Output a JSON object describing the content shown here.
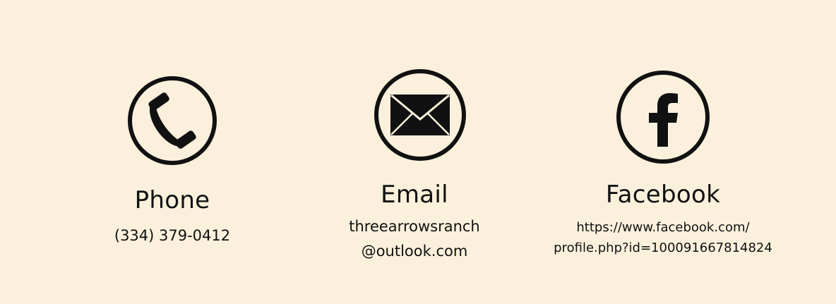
{
  "contacts": {
    "phone": {
      "icon": "phone-icon",
      "label": "Phone",
      "value": "(334) 379-0412"
    },
    "email": {
      "icon": "envelope-icon",
      "label": "Email",
      "value_line1": "threearrowsranch",
      "value_line2": "@outlook.com"
    },
    "facebook": {
      "icon": "facebook-icon",
      "label": "Facebook",
      "value_line1": "https://www.facebook.com/",
      "value_line2": "profile.php?id=100091667814824"
    }
  },
  "colors": {
    "background": "#faf0dc",
    "foreground": "#111111"
  }
}
